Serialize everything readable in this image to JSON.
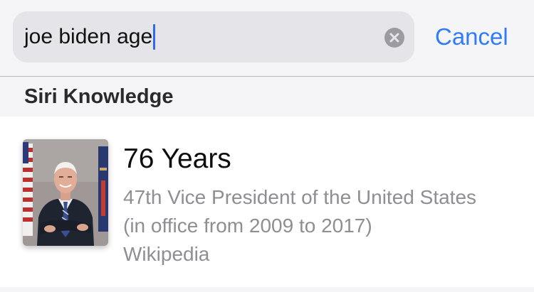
{
  "search": {
    "query": "joe biden age",
    "cancel_label": "Cancel",
    "accent_color": "#2f7cf6"
  },
  "section": {
    "title": "Siri Knowledge"
  },
  "result": {
    "title": "76 Years",
    "description": "47th Vice President of the United States (in office from 2009 to 2017)",
    "source": "Wikipedia",
    "thumbnail_icon": "person-portrait-thumbnail"
  },
  "icons": {
    "clear": "clear-circle-x-icon"
  }
}
